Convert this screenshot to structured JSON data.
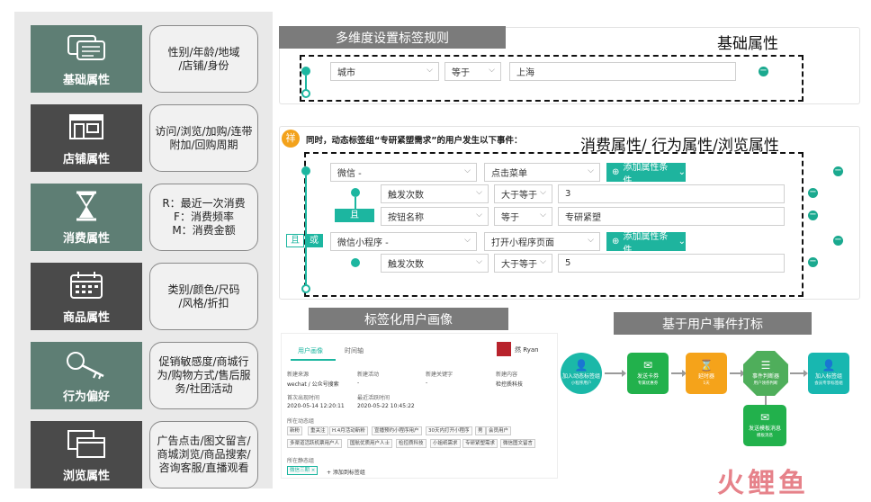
{
  "categories": [
    {
      "label": "基础属性",
      "desc": "性别/年龄/地域\n/店铺/身份",
      "style": "teal",
      "icon": "chat-bubbles-icon"
    },
    {
      "label": "店铺属性",
      "desc": "访问/浏览/加购/连带\n附加/回购周期",
      "style": "dark",
      "icon": "storefront-icon"
    },
    {
      "label": "消费属性",
      "desc": "R：最近一次消费\nF：消费频率\nM：消费金额",
      "style": "teal",
      "icon": "hourglass-icon"
    },
    {
      "label": "商品属性",
      "desc": "类别/颜色/尺码\n/风格/折扣",
      "style": "dark",
      "icon": "calendar-icon"
    },
    {
      "label": "行为偏好",
      "desc": "促销敏感度/商城行\n为/购物方式/售后服\n务/社团活动",
      "style": "teal",
      "icon": "key-icon"
    },
    {
      "label": "浏览属性",
      "desc": "广告点击/图文留言/\n商城浏览/商品搜索/\n咨询客服/直播观看",
      "style": "dark",
      "icon": "windows-icon"
    }
  ],
  "headings": {
    "multi_dim": "多维度设置标签规则",
    "basic_attr": "基础属性",
    "consume_attr": "消费属性/ 行为属性/浏览属性",
    "profile": "标签化用户画像",
    "event_tag": "基于用户事件打标"
  },
  "rule1": {
    "field": "城市",
    "op": "等于",
    "value": "上海"
  },
  "rule2": {
    "badge": "祥",
    "title": "同时，动态标签组“专研紧塑需求”的用户发生以下事件：",
    "add_cond": "添加属性条件",
    "and": "且",
    "or_a": "且",
    "or_b": "或",
    "row1": {
      "field": "微信 -",
      "op": "点击菜单"
    },
    "row2": {
      "field": "触发次数",
      "op": "大于等于",
      "value": "3"
    },
    "row3": {
      "field": "按钮名称",
      "op": "等于",
      "value": "专研紧塑"
    },
    "row4": {
      "field": "微信小程序 -",
      "op": "打开小程序页面"
    },
    "row5": {
      "field": "触发次数",
      "op": "大于等于",
      "value": "5"
    }
  },
  "profile": {
    "tab_active": "用户画像",
    "tab_other": "时间轴",
    "user_name": "然 Ryan",
    "cols": [
      "新建来源",
      "新建活动",
      "新建关键字",
      "新建内容"
    ],
    "vals": [
      "wechat / 公众号搜索",
      "-",
      "-",
      "检控质科技"
    ],
    "first_label": "首次出现时间",
    "first_val": "2020-05-14 12:20:11",
    "last_label": "最近活跃时间",
    "last_val": "2020-05-22 10:45:22",
    "dyn_label": "所在动态组",
    "tags_row1": [
      "新粉",
      "重关注",
      "H.4月活动新粉",
      "宣播预约小程序用户",
      "30天内打开小程序",
      "男",
      "会员用户"
    ],
    "tags_row2": [
      "多渠道活跃机票用户人",
      "国航优质用户人士",
      "检控质科技",
      "小姐纸需求",
      "专研紧塑需求",
      "微信图文留言"
    ],
    "static_label": "所在静态组",
    "static_tag": "微信三期 ×",
    "add_static": "+ 添加到标签组"
  },
  "flow": {
    "n1": {
      "title": "加入动态标签组",
      "sub": "小程序用户",
      "color": "#1bb8a8"
    },
    "n2": {
      "title": "发送卡券",
      "sub": "专属优惠券",
      "color": "#22b14c"
    },
    "n3": {
      "title": "延时器",
      "sub": "1天",
      "color": "#f5a31a"
    },
    "n4": {
      "title": "事件判断器",
      "sub": "用户领券判断",
      "color": "#4fae5b"
    },
    "n5": {
      "title": "加入标签组",
      "sub": "会员专享标签组",
      "color": "#18b7b0"
    },
    "n6": {
      "title": "发送模板消息",
      "sub": "模板消息",
      "color": "#22b14c"
    }
  },
  "watermark": "火鲤鱼",
  "colors": {
    "teal_tile": "#5e7e74",
    "dark_tile": "#4a4a4a",
    "accent": "#1cb6a0",
    "label_gray": "#7b7b7b"
  }
}
